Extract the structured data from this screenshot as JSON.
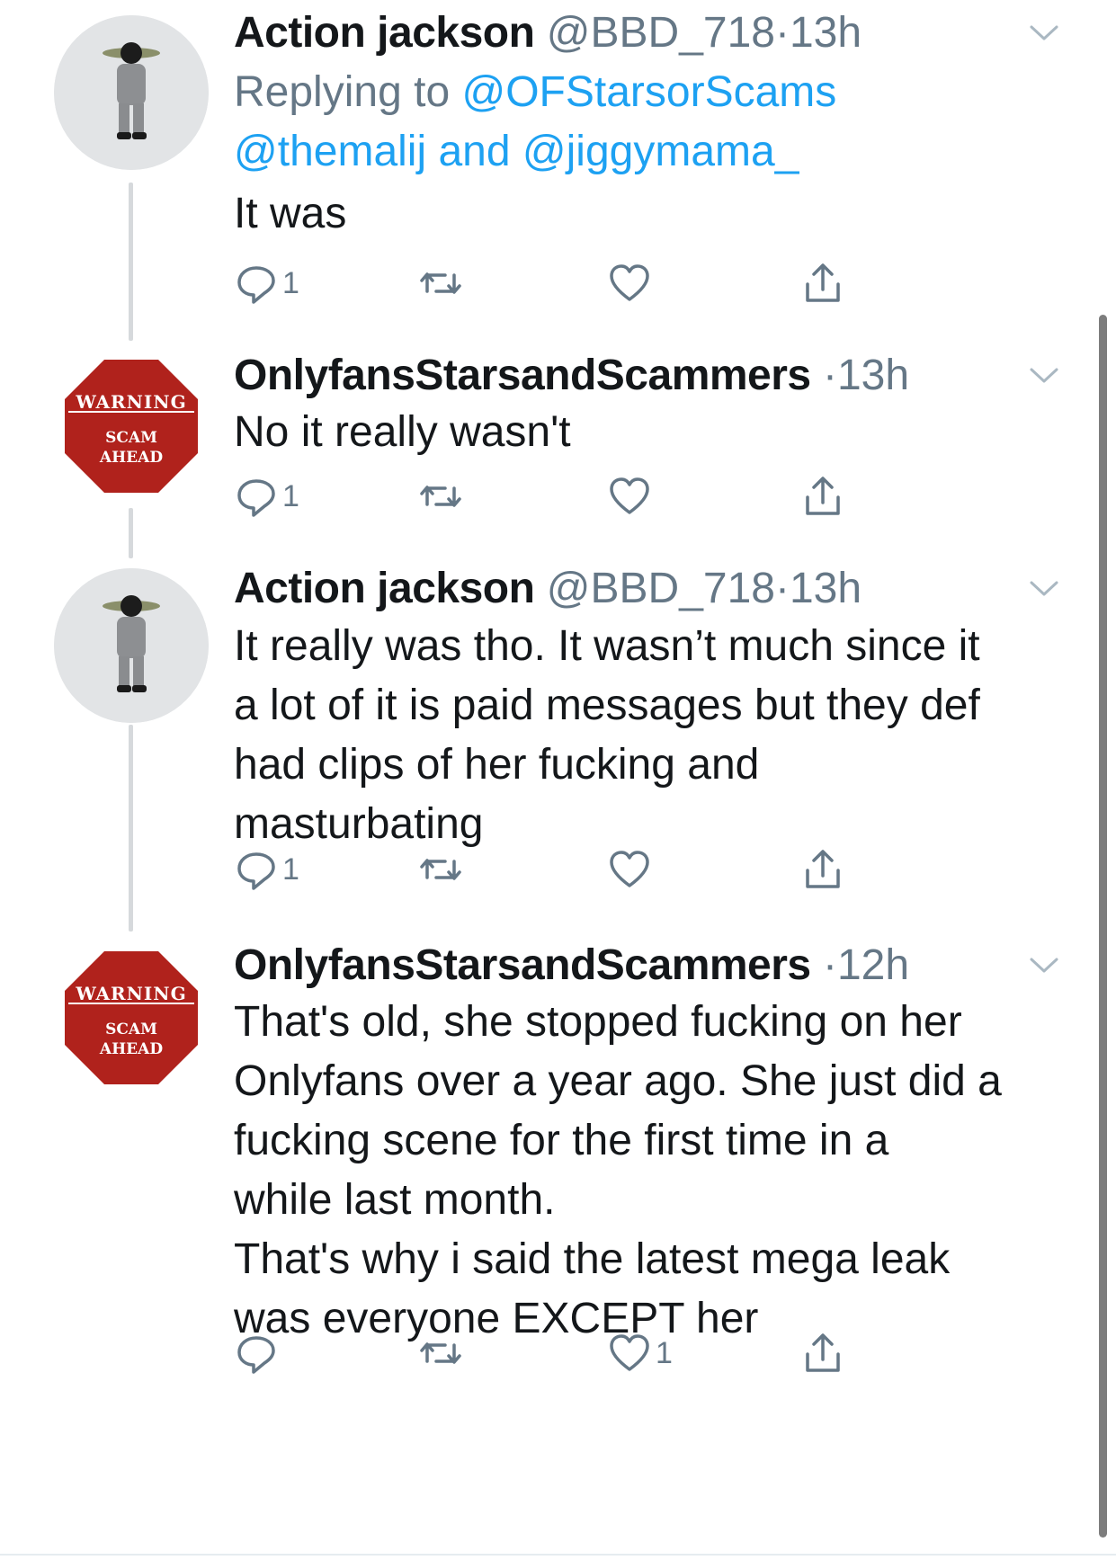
{
  "tweets": [
    {
      "name": "Action jackson",
      "handle": "@BBD_718",
      "separator": "·",
      "time": "13h",
      "reply_prefix": "Replying to",
      "reply_to_1": "@OFStarsorScams",
      "reply_to_2": "@themalij",
      "reply_conj": "and",
      "reply_to_3": "@jiggymama_",
      "lines": [
        "It was"
      ],
      "reply_count": "1",
      "like_count": "",
      "avatar_icon": "yoda-avatar-icon"
    },
    {
      "name": "OnlyfansStarsandScammers",
      "handle": "",
      "separator": "·",
      "time": "13h",
      "lines": [
        "No it really wasn't"
      ],
      "reply_count": "1",
      "like_count": "",
      "avatar_text_1": "WARNING",
      "avatar_text_2": "SCAM",
      "avatar_text_3": "AHEAD"
    },
    {
      "name": "Action jackson",
      "handle": "@BBD_718",
      "separator": "·",
      "time": "13h",
      "lines": [
        "It really was tho. It wasn’t much since it",
        "a lot of it is paid messages but they def",
        "had clips of her fucking and",
        "masturbating"
      ],
      "reply_count": "1",
      "like_count": ""
    },
    {
      "name": "OnlyfansStarsandScammers",
      "handle": "",
      "separator": "·",
      "time": "12h",
      "lines": [
        "That's old, she stopped fucking on her",
        "Onlyfans over a year ago. She just did a",
        "fucking scene for the first time in a",
        "while last month.",
        "That's why i said the latest mega leak",
        "was everyone EXCEPT her"
      ],
      "reply_count": "",
      "like_count": "1",
      "avatar_text_1": "WARNING",
      "avatar_text_2": "SCAM",
      "avatar_text_3": "AHEAD"
    }
  ],
  "colors": {
    "text": "#14171a",
    "secondary": "#657786",
    "link": "#1da1f2",
    "thread_line": "#d6d9dc",
    "warning_red": "#b0221c"
  },
  "icons": [
    "reply-icon",
    "retweet-icon",
    "like-icon",
    "share-icon",
    "chevron-down-icon"
  ]
}
